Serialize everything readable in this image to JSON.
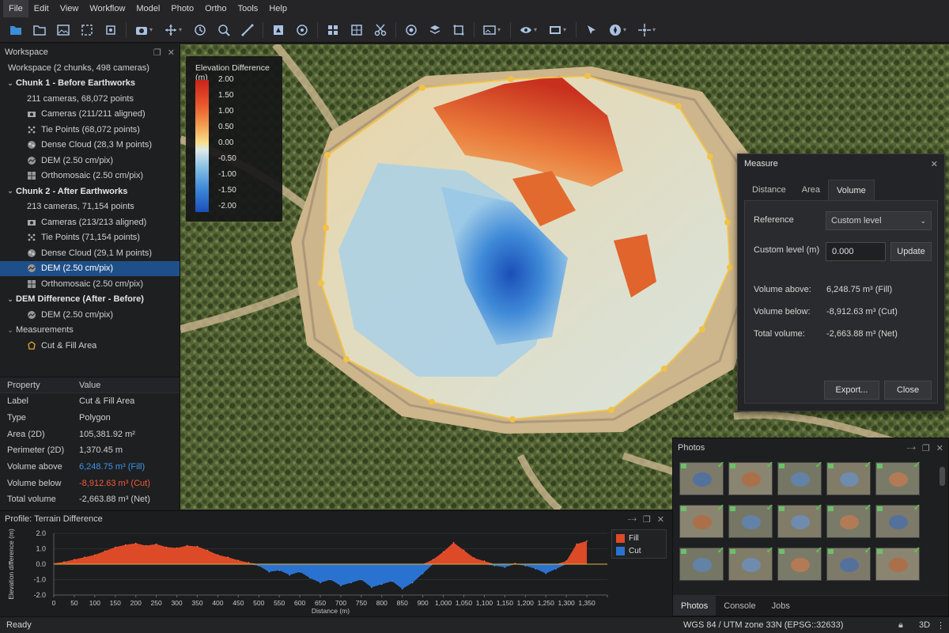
{
  "menu": [
    "File",
    "Edit",
    "View",
    "Workflow",
    "Model",
    "Photo",
    "Ortho",
    "Tools",
    "Help"
  ],
  "workspace": {
    "title": "Workspace",
    "summary": "Workspace (2 chunks, 498 cameras)",
    "tree": [
      {
        "label": "Chunk 1 - Before Earthworks",
        "level": 0,
        "bold": true,
        "icon": "none-icon",
        "twisty": "down"
      },
      {
        "label": "211 cameras, 68,072 points",
        "level": 1,
        "icon": "none-icon",
        "twisty": ""
      },
      {
        "label": "Cameras (211/211 aligned)",
        "level": 1,
        "icon": "cameras-icon",
        "twisty": ""
      },
      {
        "label": "Tie Points (68,072 points)",
        "level": 1,
        "icon": "tie-points-icon",
        "twisty": ""
      },
      {
        "label": "Dense Cloud (28,3 M points)",
        "level": 1,
        "icon": "dense-cloud-icon",
        "twisty": ""
      },
      {
        "label": "DEM (2.50 cm/pix)",
        "level": 1,
        "icon": "dem-icon",
        "twisty": ""
      },
      {
        "label": "Orthomosaic (2.50 cm/pix)",
        "level": 1,
        "icon": "orthomosaic-icon",
        "twisty": ""
      },
      {
        "label": "Chunk 2 - After Earthworks",
        "level": 0,
        "bold": true,
        "icon": "none-icon",
        "twisty": "down"
      },
      {
        "label": "213 cameras, 71,154 points",
        "level": 1,
        "icon": "none-icon",
        "twisty": ""
      },
      {
        "label": "Cameras (213/213 aligned)",
        "level": 1,
        "icon": "cameras-icon",
        "twisty": ""
      },
      {
        "label": "Tie Points (71,154 points)",
        "level": 1,
        "icon": "tie-points-icon",
        "twisty": ""
      },
      {
        "label": "Dense Cloud (29,1 M points)",
        "level": 1,
        "icon": "dense-cloud-icon",
        "twisty": ""
      },
      {
        "label": "DEM (2.50 cm/pix)",
        "level": 1,
        "icon": "dem-icon",
        "twisty": "",
        "selected": true
      },
      {
        "label": "Orthomosaic (2.50 cm/pix)",
        "level": 1,
        "icon": "orthomosaic-icon",
        "twisty": ""
      },
      {
        "label": "DEM Difference (After - Before)",
        "level": 0,
        "bold": true,
        "icon": "none-icon",
        "twisty": "down"
      },
      {
        "label": "DEM (2.50 cm/pix)",
        "level": 1,
        "icon": "dem-icon",
        "twisty": ""
      },
      {
        "label": "Measurements",
        "level": 0,
        "bold": false,
        "icon": "none-icon",
        "twisty": "down"
      },
      {
        "label": "Cut & Fill Area",
        "level": 1,
        "icon": "polygon-icon",
        "twisty": ""
      }
    ]
  },
  "properties": {
    "header_property": "Property",
    "header_value": "Value",
    "rows": [
      {
        "k": "Label",
        "v": "Cut & Fill Area",
        "style": ""
      },
      {
        "k": "Type",
        "v": "Polygon",
        "style": ""
      },
      {
        "k": "Area (2D)",
        "v": "105,381.92 m²",
        "style": ""
      },
      {
        "k": "Perimeter (2D)",
        "v": "1,370.45 m",
        "style": ""
      },
      {
        "k": "Volume above",
        "v": "6,248.75 m³ (Fill)",
        "style": "blue"
      },
      {
        "k": "Volume below",
        "v": "-8,912.63 m³ (Cut)",
        "style": "red"
      },
      {
        "k": "Total volume",
        "v": "-2,663.88 m³ (Net)",
        "style": ""
      }
    ]
  },
  "legend": {
    "title": "Elevation Difference (m)",
    "ticks": [
      "2.00",
      "1.50",
      "1.00",
      "0.50",
      "0.00",
      "-0.50",
      "-1.00",
      "-1.50",
      "-2.00"
    ]
  },
  "measure": {
    "title": "Measure",
    "tabs": [
      "Distance",
      "Area",
      "Volume"
    ],
    "active_tab": "Volume",
    "reference_label": "Reference",
    "reference_value": "Custom level",
    "custom_level_label": "Custom level (m)",
    "custom_level_value": "0.000",
    "update_label": "Update",
    "volume_above_label": "Volume above:",
    "volume_above_value": "6,248.75 m³ (Fill)",
    "volume_below_label": "Volume below:",
    "volume_below_value": "-8,912.63 m³ (Cut)",
    "total_label": "Total volume:",
    "total_value": "-2,663.88 m³ (Net)",
    "export_label": "Export...",
    "close_label": "Close"
  },
  "photos": {
    "title": "Photos",
    "tabs": [
      "Photos",
      "Console",
      "Jobs"
    ],
    "active_tab": "Photos"
  },
  "profile": {
    "title": "Profile: Terrain Difference"
  },
  "chart_data": {
    "type": "area",
    "title": "Profile: Terrain Difference",
    "xlabel": "Distance (m)",
    "ylabel": "Elevation difference (m)",
    "xlim": [
      0,
      1350
    ],
    "ylim": [
      -2.0,
      2.0
    ],
    "x_ticks": [
      0,
      50,
      100,
      150,
      200,
      250,
      300,
      350,
      400,
      450,
      500,
      550,
      600,
      650,
      700,
      750,
      800,
      850,
      900,
      950,
      1000,
      1050,
      1100,
      1150,
      1200,
      1250,
      1300,
      1350
    ],
    "x_tick_labels": [
      "0",
      "50",
      "100",
      "150",
      "200",
      "250",
      "300",
      "350",
      "400",
      "450",
      "500",
      "550",
      "600",
      "650",
      "700",
      "750",
      "800",
      "850",
      "900",
      "1,000",
      "1,050",
      "1,100",
      "1,150",
      "1,200",
      "1,250",
      "1,300",
      "1,350"
    ],
    "y_ticks": [
      2.0,
      1.0,
      0.0,
      -1.0,
      -2.0
    ],
    "y_tick_labels": [
      "2.0",
      "1.0",
      "0.0",
      "-1.0",
      "-2.0"
    ],
    "legend": [
      "Fill",
      "Cut"
    ],
    "legend_position": "top-right",
    "colors": {
      "fill": "#dd4a28",
      "cut": "#2a72d0"
    },
    "series": {
      "x": [
        0,
        25,
        50,
        75,
        100,
        125,
        150,
        175,
        200,
        225,
        250,
        275,
        300,
        325,
        350,
        375,
        400,
        425,
        450,
        475,
        500,
        525,
        550,
        575,
        600,
        625,
        650,
        675,
        700,
        725,
        750,
        775,
        800,
        825,
        850,
        875,
        900,
        925,
        950,
        975,
        1000,
        1025,
        1050,
        1075,
        1100,
        1125,
        1150,
        1175,
        1200,
        1225,
        1250,
        1275,
        1300
      ],
      "y": [
        0.05,
        0.15,
        0.3,
        0.45,
        0.6,
        0.85,
        1.1,
        1.25,
        1.35,
        1.2,
        1.3,
        1.1,
        1.05,
        1.2,
        1.15,
        0.9,
        0.6,
        0.45,
        0.25,
        0.1,
        -0.1,
        -0.5,
        -0.4,
        -0.7,
        -0.5,
        -0.9,
        -1.2,
        -1.0,
        -1.4,
        -1.2,
        -1.0,
        -1.5,
        -1.3,
        -1.1,
        -1.6,
        -1.2,
        -0.6,
        0.3,
        0.8,
        1.4,
        0.9,
        0.4,
        0.2,
        -0.1,
        -0.2,
        0.05,
        -0.1,
        -0.3,
        -0.6,
        -0.3,
        0.2,
        1.3,
        1.5
      ]
    }
  },
  "status": {
    "left": "Ready",
    "crs": "WGS 84 / UTM zone 33N (EPSG::32633)",
    "view_mode": "3D"
  }
}
